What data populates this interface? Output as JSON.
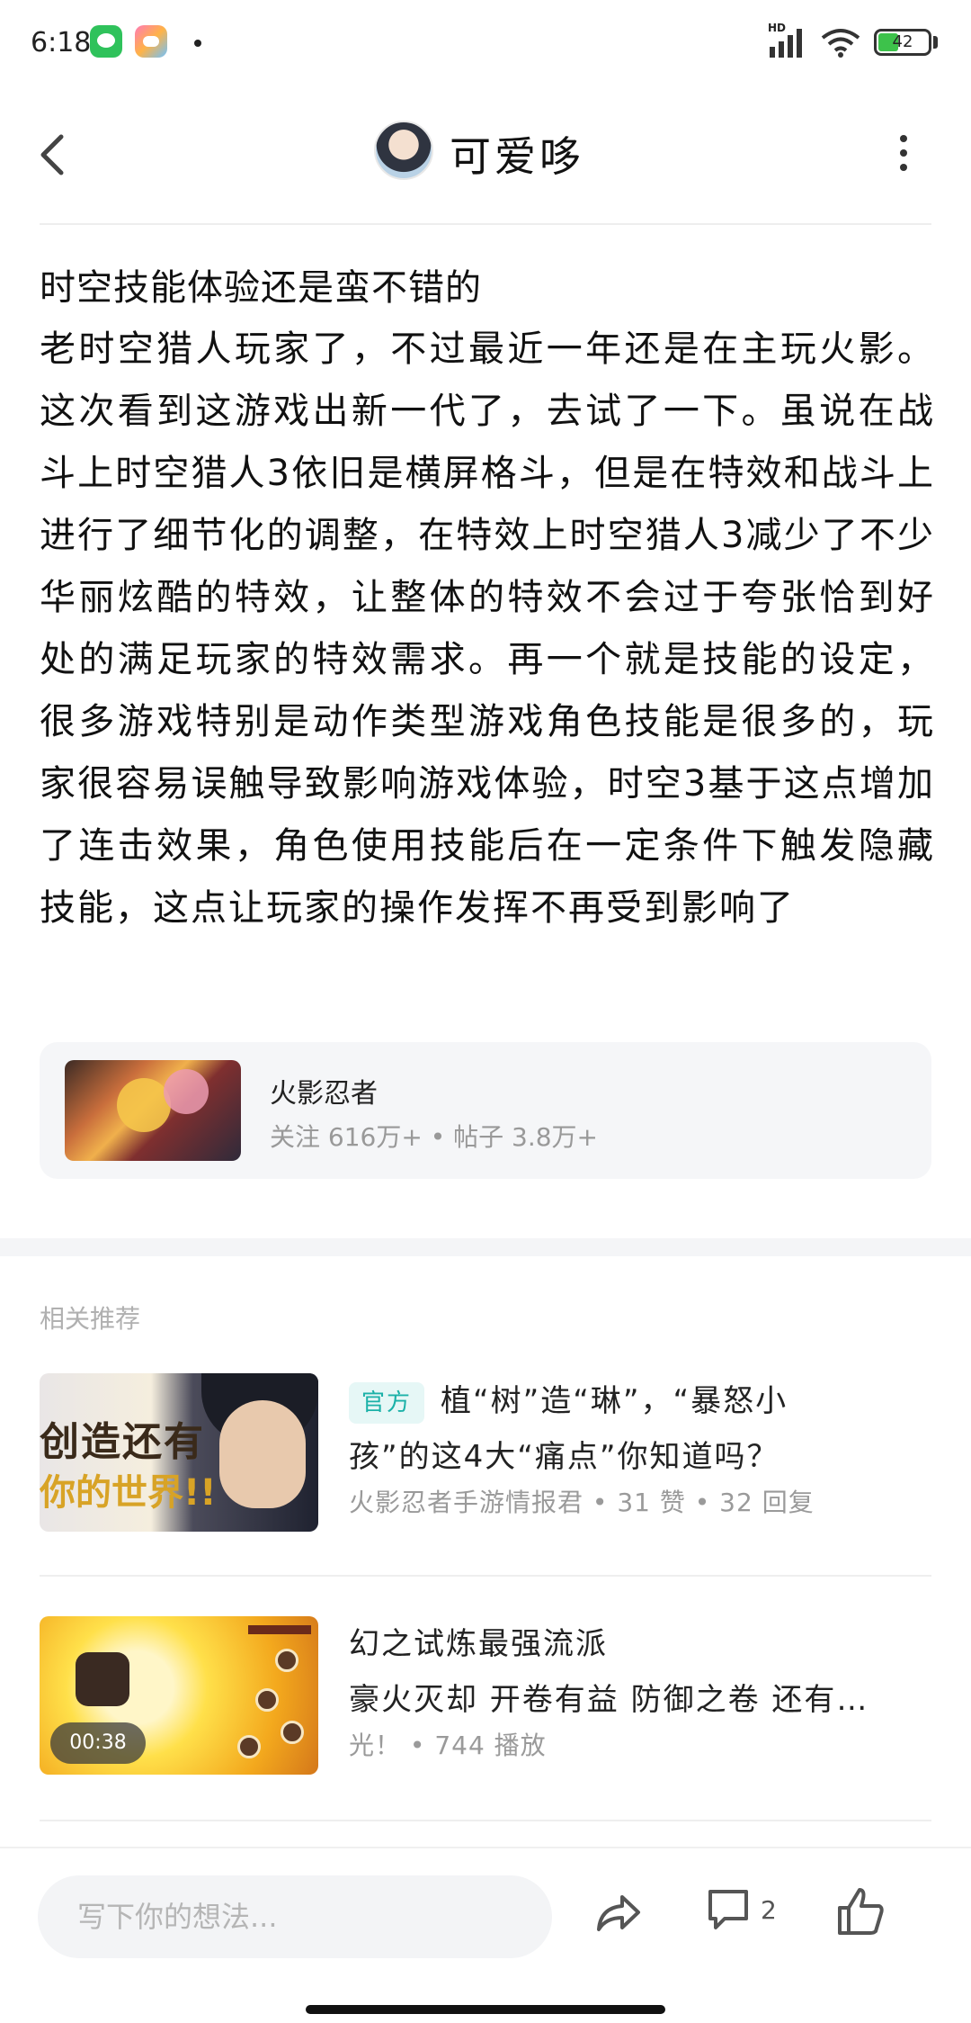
{
  "status_bar": {
    "time": "6:18",
    "network": "HD",
    "battery": "42"
  },
  "header": {
    "user_name": "可爱哆"
  },
  "post": {
    "title": "时空技能体验还是蛮不错的",
    "body": "老时空猎人玩家了，不过最近一年还是在主玩火影。这次看到这游戏出新一代了，去试了一下。虽说在战斗上时空猎人3依旧是横屏格斗，但是在特效和战斗上进行了细节化的调整，在特效上时空猎人3减少了不少华丽炫酷的特效，让整体的特效不会过于夸张恰到好处的满足玩家的特效需求。再一个就是技能的设定，很多游戏特别是动作类型游戏角色技能是很多的，玩家很容易误触导致影响游戏体验，时空3基于这点增加了连击效果，角色使用技能后在一定条件下触发隐藏技能，这点让玩家的操作发挥不再受到影响了"
  },
  "forum_card": {
    "name": "火影忍者",
    "stats": "关注 616万+ • 帖子 3.8万+"
  },
  "related": {
    "title": "相关推荐",
    "items": [
      {
        "badge": "官方",
        "line1": "植“树”造“琳”，“暴怒小",
        "line2": "孩”的这4大“痛点”你知道吗？",
        "meta": "火影忍者手游情报君 • 31 赞 • 32 回复",
        "thumb_text1": "创造还有",
        "thumb_text2": "你的世界!!"
      },
      {
        "line1": "幻之试炼最强流派",
        "line2": "豪火灭却 开卷有益 防御之卷 还有…",
        "meta": "光！ • 744 播放",
        "duration": "00:38"
      }
    ]
  },
  "bottom_bar": {
    "input_placeholder": "写下你的想法...",
    "comment_count": "2"
  },
  "colors": {
    "accent": "#1bb1a8",
    "battery": "#3dc24b"
  }
}
